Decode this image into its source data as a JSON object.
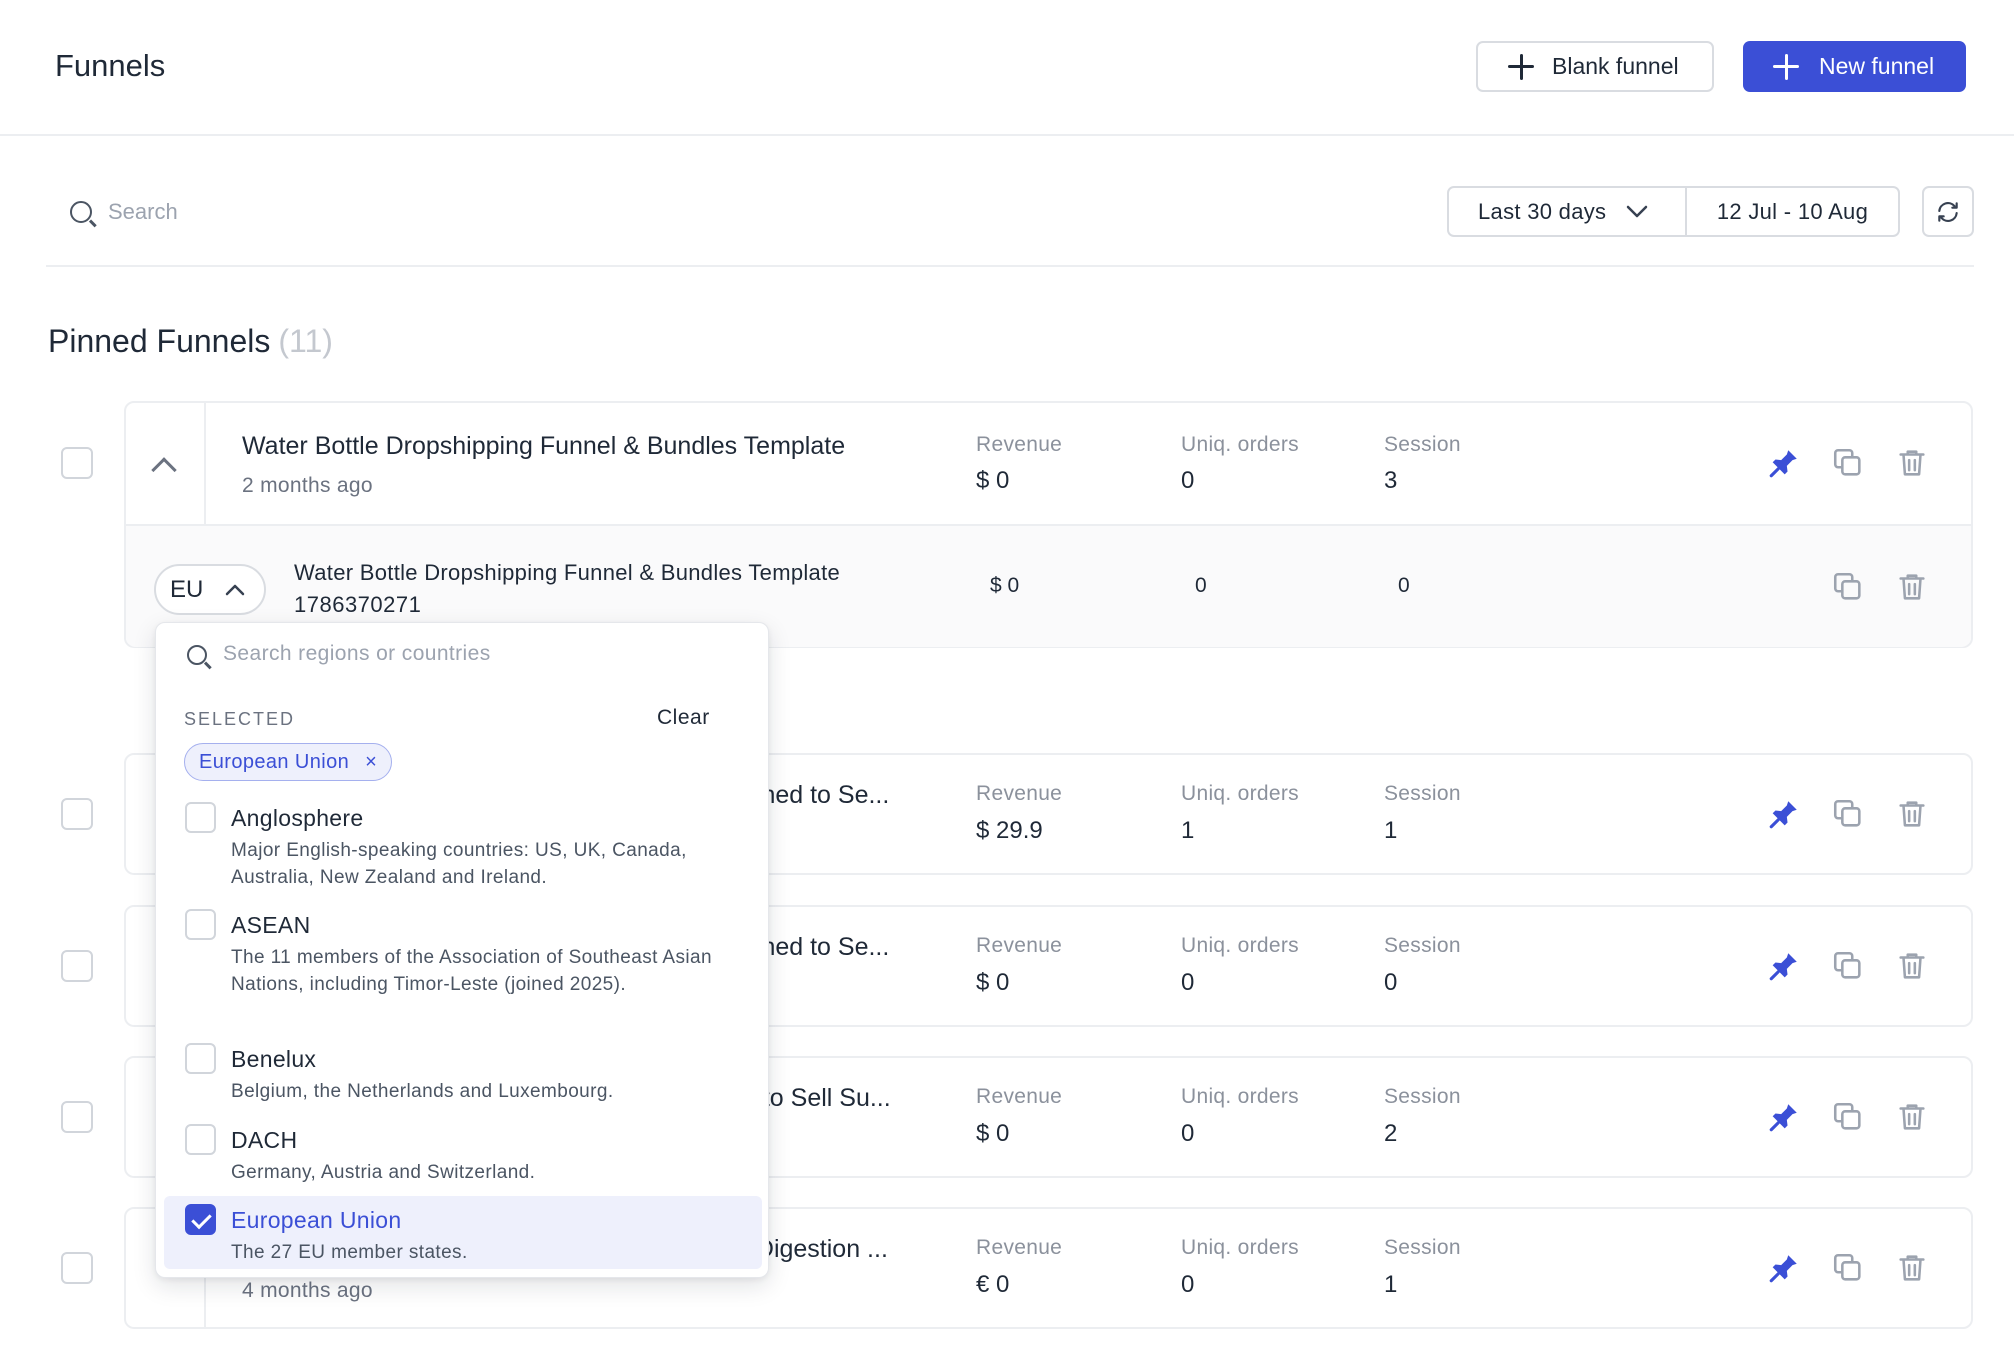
{
  "header": {
    "title": "Funnels",
    "blank_funnel_label": "Blank funnel",
    "new_funnel_label": "New funnel"
  },
  "toolbar": {
    "search_placeholder": "Search",
    "range_label": "Last 30 days",
    "date_range": "12 Jul - 10 Aug"
  },
  "section": {
    "title": "Pinned Funnels",
    "count": "(11)"
  },
  "metric_labels": {
    "revenue": "Revenue",
    "orders": "Uniq. orders",
    "session": "Session"
  },
  "funnels": [
    {
      "title": "Water Bottle Dropshipping Funnel & Bundles Template",
      "sub": "2 months ago",
      "revenue": "$ 0",
      "orders": "0",
      "session": "3"
    },
    {
      "title": "igned to Se...",
      "sub": "",
      "revenue": "$ 29.9",
      "orders": "1",
      "session": "1"
    },
    {
      "title": "igned to Se...",
      "sub": "",
      "revenue": "$ 0",
      "orders": "0",
      "session": "0"
    },
    {
      "title": "d to Sell Su...",
      "sub": "",
      "revenue": "$ 0",
      "orders": "0",
      "session": "2"
    },
    {
      "title": ", Digestion ...",
      "sub": "4 months ago",
      "revenue": "€ 0",
      "orders": "0",
      "session": "1"
    }
  ],
  "sub_row": {
    "region": "EU",
    "title": "Water Bottle Dropshipping Funnel & Bundles Template",
    "id": "1786370271",
    "revenue": "$ 0",
    "orders": "0",
    "session": "0"
  },
  "region_dropdown": {
    "search_placeholder": "Search regions or countries",
    "selected_label": "SELECTED",
    "clear_label": "Clear",
    "chip": "European Union",
    "chip_remove": "×",
    "options": [
      {
        "name": "Anglosphere",
        "desc": "Major English-speaking countries: US, UK, Canada, Australia, New Zealand and Ireland.",
        "checked": false
      },
      {
        "name": "ASEAN",
        "desc": "The 11 members of the Association of Southeast Asian Nations, including Timor-Leste (joined 2025).",
        "checked": false
      },
      {
        "name": "Benelux",
        "desc": "Belgium, the Netherlands and Luxembourg.",
        "checked": false
      },
      {
        "name": "DACH",
        "desc": "Germany, Austria and Switzerland.",
        "checked": false
      },
      {
        "name": "European Union",
        "desc": "The 27 EU member states.",
        "checked": true
      }
    ]
  },
  "colors": {
    "accent": "#3b4fd6",
    "pin": "#3b4fd6",
    "muted_icon": "#9ca3af",
    "border": "#eceef1"
  }
}
